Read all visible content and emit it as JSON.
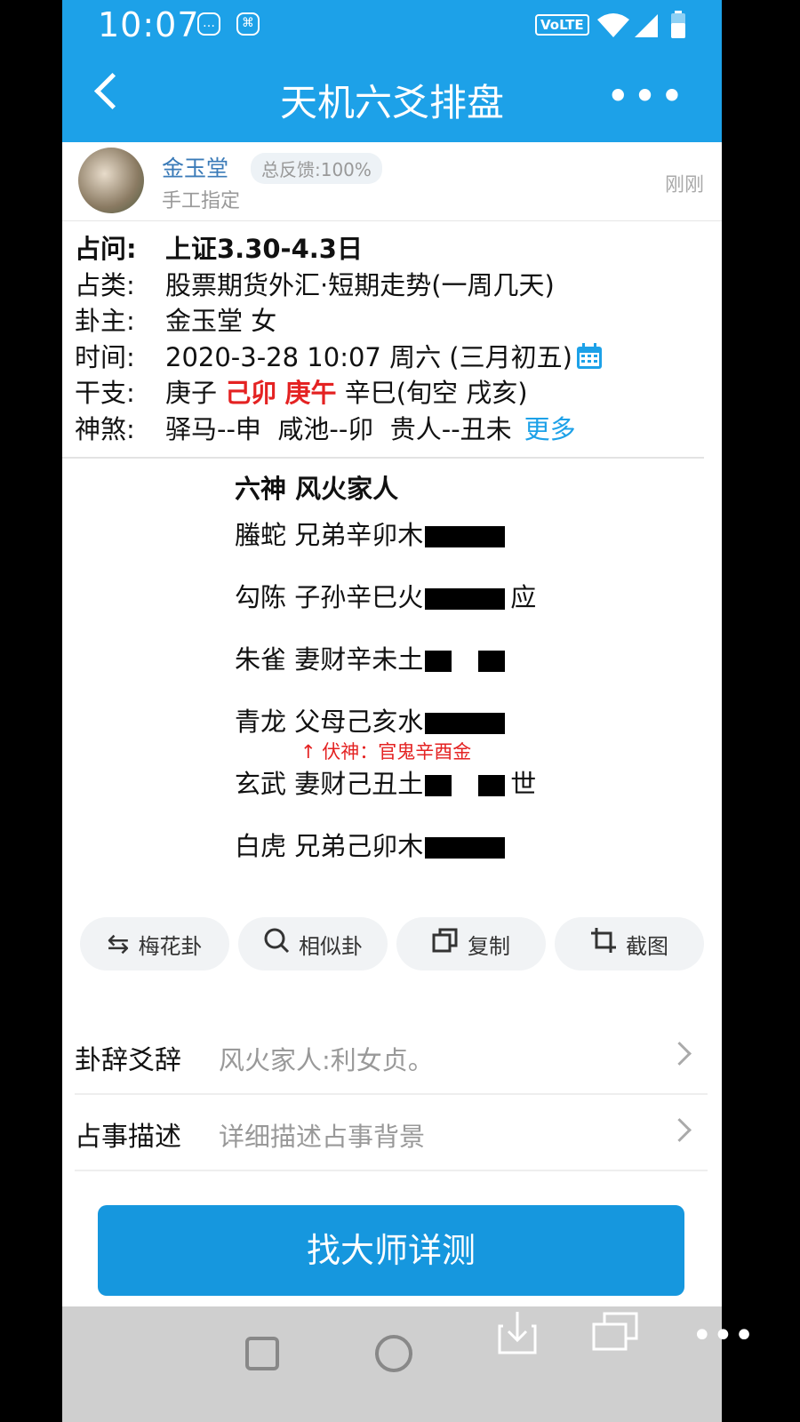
{
  "status": {
    "time": "10:07",
    "network": "VoLTE"
  },
  "nav": {
    "title": "天机六爻排盘"
  },
  "author": {
    "name": "金玉堂",
    "feedback": "总反馈:100%",
    "sub": "手工指定",
    "time": "刚刚"
  },
  "info": {
    "ask_label": "占问:",
    "ask_value": "上证3.30-4.3日",
    "cat_label": "占类:",
    "cat_value": "股票期货外汇·短期走势(一周几天)",
    "owner_label": "卦主:",
    "owner_value": "金玉堂 女",
    "time_label": "时间:",
    "time_value": "2020-3-28 10:07 周六 (三月初五)",
    "gz_label": "干支:",
    "gz_1": "庚子",
    "gz_2": "己卯",
    "gz_3": "庚午",
    "gz_4": "辛巳",
    "gz_kong": "(旬空 戌亥)",
    "ss_label": "神煞:",
    "ss_value": "驿马--申  咸池--卯  贵人--丑未",
    "ss_more": "更多"
  },
  "hexagram": {
    "header": "六神 风火家人",
    "lines": [
      {
        "text": "螣蛇 兄弟辛卯木",
        "type": "yang",
        "mark": ""
      },
      {
        "text": "勾陈 子孙辛巳火",
        "type": "yang",
        "mark": "应"
      },
      {
        "text": "朱雀 妻财辛未土",
        "type": "yin",
        "mark": ""
      },
      {
        "text": "青龙 父母己亥水",
        "type": "yang",
        "mark": ""
      },
      {
        "text": "玄武 妻财己丑土",
        "type": "yin",
        "mark": "世"
      },
      {
        "text": "白虎 兄弟己卯木",
        "type": "yang",
        "mark": ""
      }
    ],
    "fushen": "↑ 伏神：官鬼辛酉金"
  },
  "actions": {
    "meihua": "梅花卦",
    "similar": "相似卦",
    "copy": "复制",
    "screenshot": "截图"
  },
  "rows": {
    "guaci_label": "卦辞爻辞",
    "guaci_value": "风火家人:利女贞。",
    "desc_label": "占事描述",
    "desc_placeholder": "详细描述占事背景"
  },
  "cta": {
    "label": "找大师详测"
  }
}
